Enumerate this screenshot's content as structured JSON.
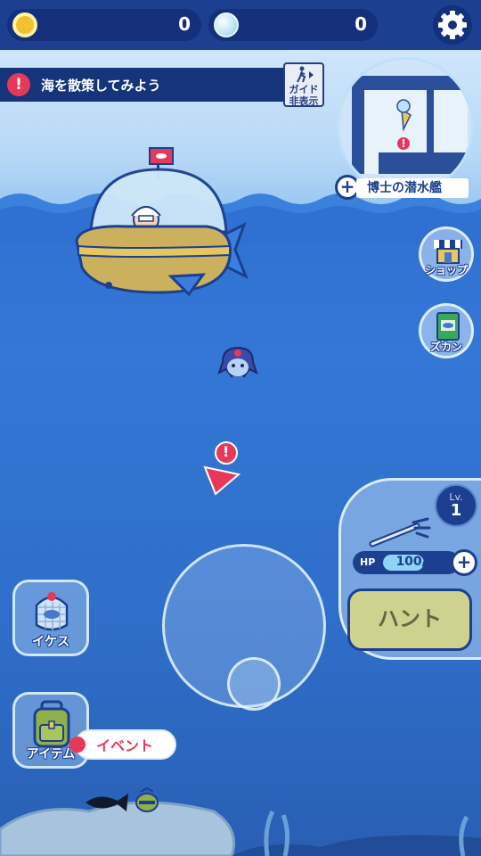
{
  "hud": {
    "coins": "0",
    "pearls": "0"
  },
  "quest": {
    "alert_glyph": "!",
    "text": "海を散策してみよう",
    "guide_label_line1": "ガイド",
    "guide_label_line2": "非表示"
  },
  "minimap": {
    "label": "博士の潜水艦",
    "plus": "+"
  },
  "side_buttons": {
    "shop": "ショップ",
    "zukan": "ズカン"
  },
  "left_buttons": {
    "ikesu": "イケス",
    "item": "アイテム"
  },
  "event": {
    "label": "イベント"
  },
  "hunt": {
    "level_label": "Lv.",
    "level_value": "1",
    "hp_label": "HP",
    "hp_value": "100/100",
    "hp_fraction": 1.0,
    "plus": "+",
    "hunt_label": "ハント"
  },
  "waypoint": {
    "alert_glyph": "!"
  },
  "colors": {
    "accent_red": "#e6395a",
    "navy": "#1c3f8f",
    "ocean": "#2f6fd0"
  }
}
